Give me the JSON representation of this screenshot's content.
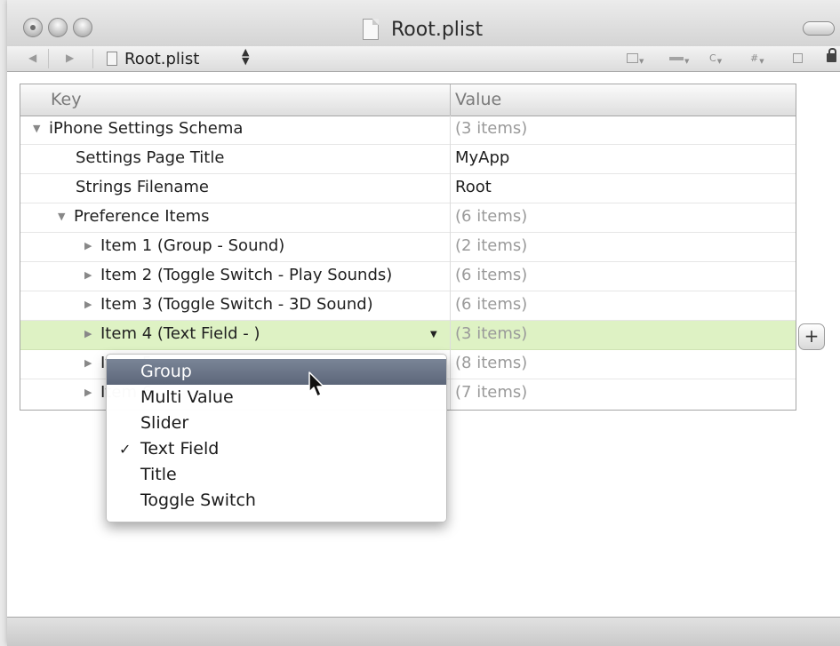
{
  "window": {
    "title": "Root.plist"
  },
  "navbar": {
    "file": "Root.plist",
    "tools": [
      {
        "icon": "window-menu-icon",
        "label": ""
      },
      {
        "icon": "bookmark-menu-icon",
        "label": ""
      },
      {
        "icon": "class-menu-icon",
        "label": "C"
      },
      {
        "icon": "include-menu-icon",
        "label": "#"
      },
      {
        "icon": "split-icon",
        "label": ""
      }
    ]
  },
  "table": {
    "headers": {
      "key": "Key",
      "value": "Value"
    },
    "rows": [
      {
        "key": "iPhone Settings Schema",
        "value": "(3 items)",
        "level": 0,
        "disclosure": "open",
        "muted": true
      },
      {
        "key": "Settings Page Title",
        "value": "MyApp",
        "level": 1,
        "disclosure": "none",
        "muted": false
      },
      {
        "key": "Strings Filename",
        "value": "Root",
        "level": 1,
        "disclosure": "none",
        "muted": false
      },
      {
        "key": "Preference Items",
        "value": "(6 items)",
        "level": 1,
        "disclosure": "open",
        "muted": true
      },
      {
        "key": "Item 1 (Group - Sound)",
        "value": "(2 items)",
        "level": 2,
        "disclosure": "closed",
        "muted": true
      },
      {
        "key": "Item 2 (Toggle Switch - Play Sounds)",
        "value": "(6 items)",
        "level": 2,
        "disclosure": "closed",
        "muted": true
      },
      {
        "key": "Item 3 (Toggle Switch - 3D Sound)",
        "value": "(6 items)",
        "level": 2,
        "disclosure": "closed",
        "muted": true
      },
      {
        "key": "Item 4 (Text Field - )",
        "value": "(3 items)",
        "level": 2,
        "disclosure": "closed",
        "muted": true,
        "selected": true
      },
      {
        "key": "Item 5",
        "value": "(8 items)",
        "level": 2,
        "disclosure": "closed",
        "muted": true
      },
      {
        "key": "Item 6",
        "value": "(7 items)",
        "level": 2,
        "disclosure": "closed",
        "muted": true
      }
    ]
  },
  "add_button": "+",
  "type_menu": {
    "items": [
      "Group",
      "Multi Value",
      "Slider",
      "Text Field",
      "Title",
      "Toggle Switch"
    ],
    "highlighted": "Group",
    "checked": "Text Field",
    "check_mark": "✓"
  }
}
